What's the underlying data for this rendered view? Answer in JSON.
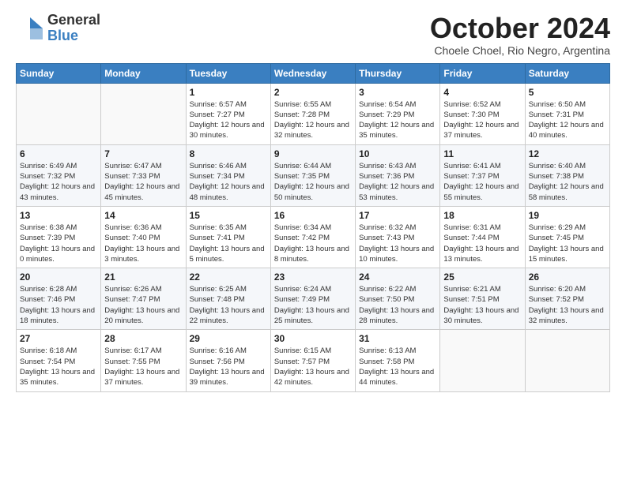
{
  "header": {
    "logo_general": "General",
    "logo_blue": "Blue",
    "month_title": "October 2024",
    "location": "Choele Choel, Rio Negro, Argentina"
  },
  "days_of_week": [
    "Sunday",
    "Monday",
    "Tuesday",
    "Wednesday",
    "Thursday",
    "Friday",
    "Saturday"
  ],
  "weeks": [
    [
      {
        "day": "",
        "info": ""
      },
      {
        "day": "",
        "info": ""
      },
      {
        "day": "1",
        "info": "Sunrise: 6:57 AM\nSunset: 7:27 PM\nDaylight: 12 hours and 30 minutes."
      },
      {
        "day": "2",
        "info": "Sunrise: 6:55 AM\nSunset: 7:28 PM\nDaylight: 12 hours and 32 minutes."
      },
      {
        "day": "3",
        "info": "Sunrise: 6:54 AM\nSunset: 7:29 PM\nDaylight: 12 hours and 35 minutes."
      },
      {
        "day": "4",
        "info": "Sunrise: 6:52 AM\nSunset: 7:30 PM\nDaylight: 12 hours and 37 minutes."
      },
      {
        "day": "5",
        "info": "Sunrise: 6:50 AM\nSunset: 7:31 PM\nDaylight: 12 hours and 40 minutes."
      }
    ],
    [
      {
        "day": "6",
        "info": "Sunrise: 6:49 AM\nSunset: 7:32 PM\nDaylight: 12 hours and 43 minutes."
      },
      {
        "day": "7",
        "info": "Sunrise: 6:47 AM\nSunset: 7:33 PM\nDaylight: 12 hours and 45 minutes."
      },
      {
        "day": "8",
        "info": "Sunrise: 6:46 AM\nSunset: 7:34 PM\nDaylight: 12 hours and 48 minutes."
      },
      {
        "day": "9",
        "info": "Sunrise: 6:44 AM\nSunset: 7:35 PM\nDaylight: 12 hours and 50 minutes."
      },
      {
        "day": "10",
        "info": "Sunrise: 6:43 AM\nSunset: 7:36 PM\nDaylight: 12 hours and 53 minutes."
      },
      {
        "day": "11",
        "info": "Sunrise: 6:41 AM\nSunset: 7:37 PM\nDaylight: 12 hours and 55 minutes."
      },
      {
        "day": "12",
        "info": "Sunrise: 6:40 AM\nSunset: 7:38 PM\nDaylight: 12 hours and 58 minutes."
      }
    ],
    [
      {
        "day": "13",
        "info": "Sunrise: 6:38 AM\nSunset: 7:39 PM\nDaylight: 13 hours and 0 minutes."
      },
      {
        "day": "14",
        "info": "Sunrise: 6:36 AM\nSunset: 7:40 PM\nDaylight: 13 hours and 3 minutes."
      },
      {
        "day": "15",
        "info": "Sunrise: 6:35 AM\nSunset: 7:41 PM\nDaylight: 13 hours and 5 minutes."
      },
      {
        "day": "16",
        "info": "Sunrise: 6:34 AM\nSunset: 7:42 PM\nDaylight: 13 hours and 8 minutes."
      },
      {
        "day": "17",
        "info": "Sunrise: 6:32 AM\nSunset: 7:43 PM\nDaylight: 13 hours and 10 minutes."
      },
      {
        "day": "18",
        "info": "Sunrise: 6:31 AM\nSunset: 7:44 PM\nDaylight: 13 hours and 13 minutes."
      },
      {
        "day": "19",
        "info": "Sunrise: 6:29 AM\nSunset: 7:45 PM\nDaylight: 13 hours and 15 minutes."
      }
    ],
    [
      {
        "day": "20",
        "info": "Sunrise: 6:28 AM\nSunset: 7:46 PM\nDaylight: 13 hours and 18 minutes."
      },
      {
        "day": "21",
        "info": "Sunrise: 6:26 AM\nSunset: 7:47 PM\nDaylight: 13 hours and 20 minutes."
      },
      {
        "day": "22",
        "info": "Sunrise: 6:25 AM\nSunset: 7:48 PM\nDaylight: 13 hours and 22 minutes."
      },
      {
        "day": "23",
        "info": "Sunrise: 6:24 AM\nSunset: 7:49 PM\nDaylight: 13 hours and 25 minutes."
      },
      {
        "day": "24",
        "info": "Sunrise: 6:22 AM\nSunset: 7:50 PM\nDaylight: 13 hours and 28 minutes."
      },
      {
        "day": "25",
        "info": "Sunrise: 6:21 AM\nSunset: 7:51 PM\nDaylight: 13 hours and 30 minutes."
      },
      {
        "day": "26",
        "info": "Sunrise: 6:20 AM\nSunset: 7:52 PM\nDaylight: 13 hours and 32 minutes."
      }
    ],
    [
      {
        "day": "27",
        "info": "Sunrise: 6:18 AM\nSunset: 7:54 PM\nDaylight: 13 hours and 35 minutes."
      },
      {
        "day": "28",
        "info": "Sunrise: 6:17 AM\nSunset: 7:55 PM\nDaylight: 13 hours and 37 minutes."
      },
      {
        "day": "29",
        "info": "Sunrise: 6:16 AM\nSunset: 7:56 PM\nDaylight: 13 hours and 39 minutes."
      },
      {
        "day": "30",
        "info": "Sunrise: 6:15 AM\nSunset: 7:57 PM\nDaylight: 13 hours and 42 minutes."
      },
      {
        "day": "31",
        "info": "Sunrise: 6:13 AM\nSunset: 7:58 PM\nDaylight: 13 hours and 44 minutes."
      },
      {
        "day": "",
        "info": ""
      },
      {
        "day": "",
        "info": ""
      }
    ]
  ]
}
